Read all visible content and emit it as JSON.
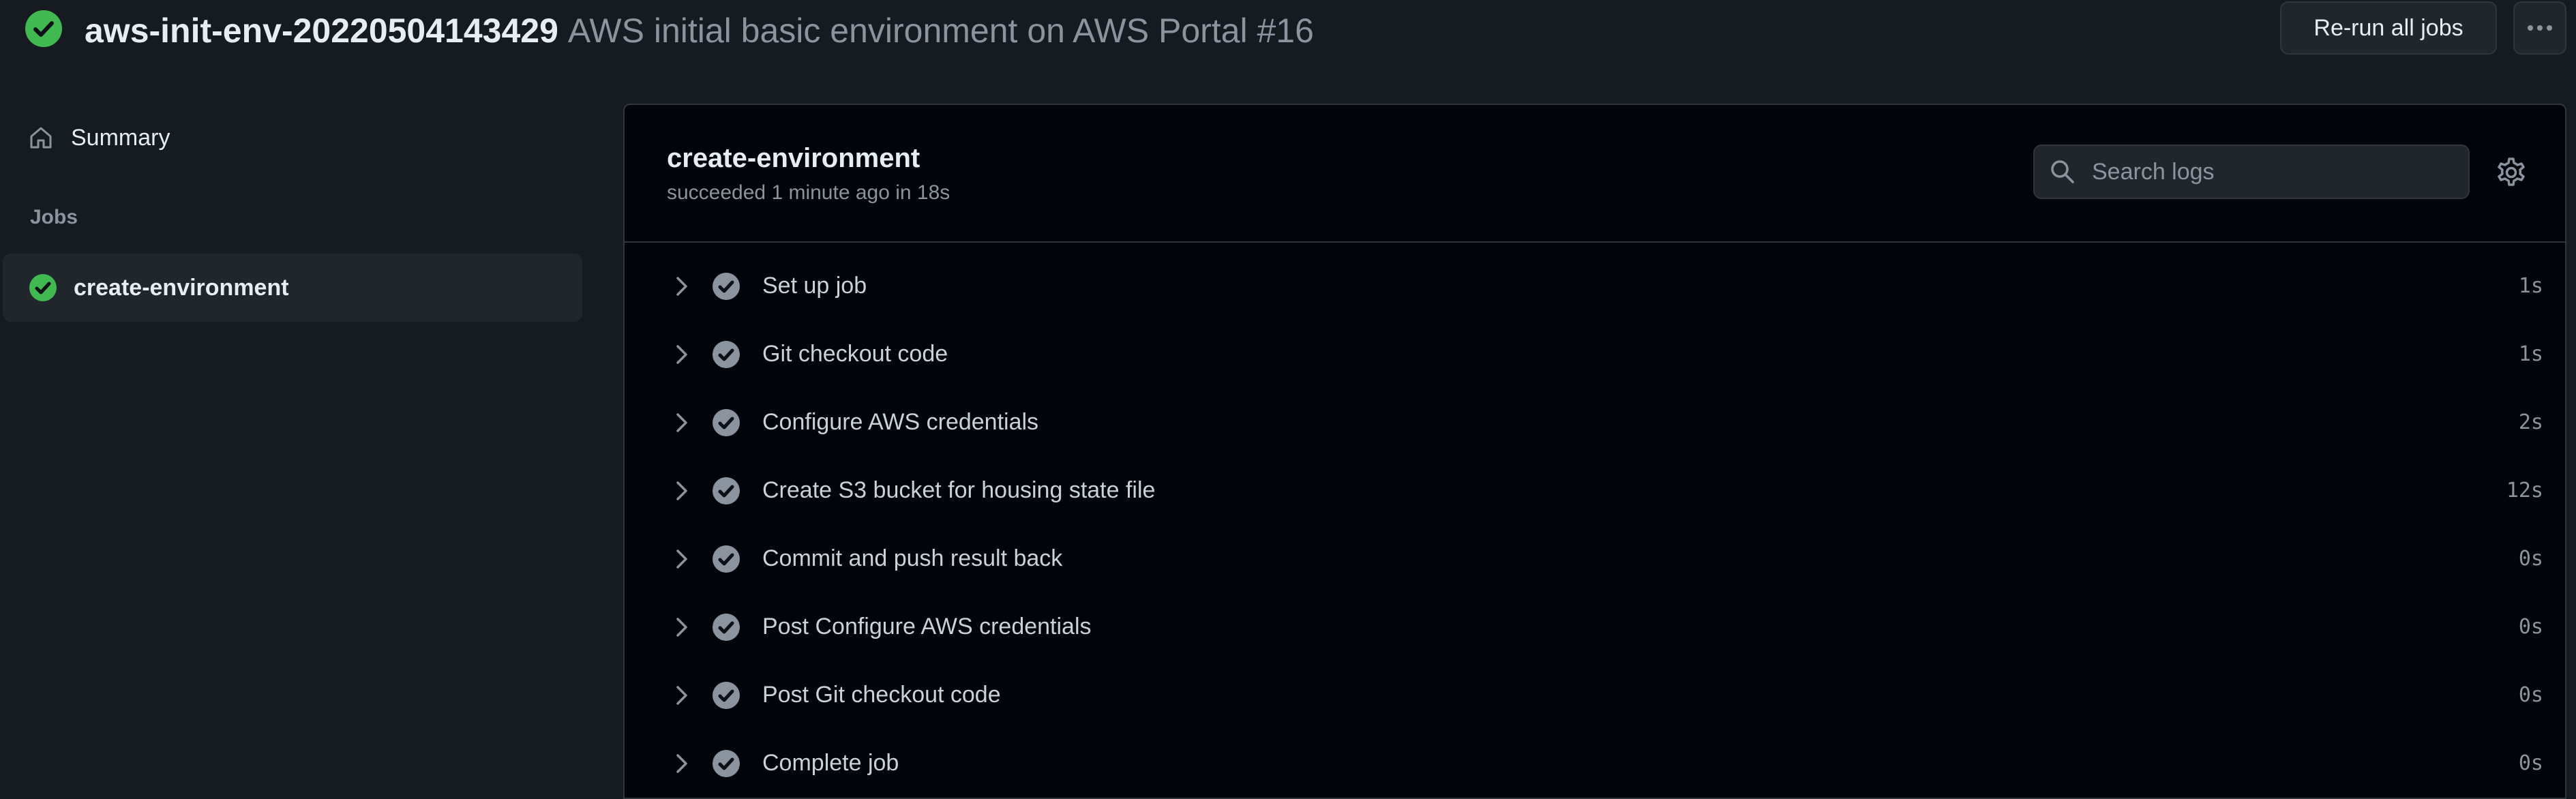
{
  "header": {
    "workflow_name": "aws-init-env-20220504143429",
    "run_title": "AWS initial basic environment on AWS Portal #16",
    "rerun_label": "Re-run all jobs",
    "status_icon": "success-check-icon"
  },
  "sidebar": {
    "summary_label": "Summary",
    "jobs_heading": "Jobs",
    "jobs": [
      {
        "label": "create-environment",
        "status": "success"
      }
    ]
  },
  "job": {
    "title": "create-environment",
    "status_text": "succeeded 1 minute ago in 18s",
    "search_placeholder": "Search logs",
    "steps": [
      {
        "name": "Set up job",
        "duration": "1s"
      },
      {
        "name": "Git checkout code",
        "duration": "1s"
      },
      {
        "name": "Configure AWS credentials",
        "duration": "2s"
      },
      {
        "name": "Create S3 bucket for housing state file",
        "duration": "12s"
      },
      {
        "name": "Commit and push result back",
        "duration": "0s"
      },
      {
        "name": "Post Configure AWS credentials",
        "duration": "0s"
      },
      {
        "name": "Post Git checkout code",
        "duration": "0s"
      },
      {
        "name": "Complete job",
        "duration": "0s"
      }
    ]
  },
  "colors": {
    "success": "#3fb950",
    "step_check": "#8b949e",
    "background": "#161b22",
    "panel": "#010409"
  }
}
